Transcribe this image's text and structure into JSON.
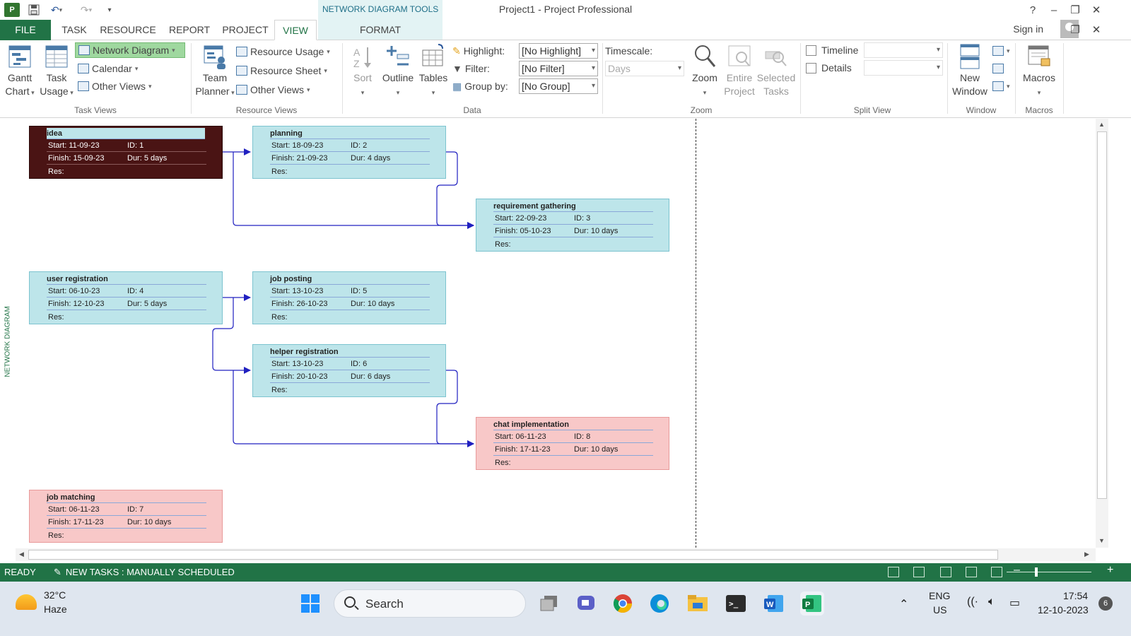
{
  "titlebar": {
    "app_icon": "P",
    "contextual_tab_group": "NETWORK DIAGRAM TOOLS",
    "window_title": "Project1 - Project Professional",
    "help": "?"
  },
  "tabs": [
    {
      "label": "FILE"
    },
    {
      "label": "TASK"
    },
    {
      "label": "RESOURCE"
    },
    {
      "label": "REPORT"
    },
    {
      "label": "PROJECT"
    },
    {
      "label": "VIEW"
    },
    {
      "label": "FORMAT"
    }
  ],
  "signin": "Sign in",
  "ribbon": {
    "task_views": {
      "label": "Task Views",
      "gantt_chart": [
        "Gantt",
        "Chart"
      ],
      "task_usage": [
        "Task",
        "Usage"
      ],
      "network_diagram": "Network Diagram",
      "calendar": "Calendar",
      "other_views": "Other Views"
    },
    "resource_views": {
      "label": "Resource Views",
      "team_planner": [
        "Team",
        "Planner"
      ],
      "resource_usage": "Resource Usage",
      "resource_sheet": "Resource Sheet",
      "other_views": "Other Views"
    },
    "data": {
      "label": "Data",
      "sort": "Sort",
      "outline": "Outline",
      "tables": "Tables",
      "highlight_label": "Highlight:",
      "highlight_value": "[No Highlight]",
      "filter_label": "Filter:",
      "filter_value": "[No Filter]",
      "groupby_label": "Group by:",
      "groupby_value": "[No Group]"
    },
    "zoom": {
      "label": "Zoom",
      "timescale_label": "Timescale:",
      "timescale_value": "Days",
      "zoom": "Zoom",
      "entire_project": [
        "Entire",
        "Project"
      ],
      "selected_tasks": [
        "Selected",
        "Tasks"
      ]
    },
    "split_view": {
      "label": "Split View",
      "timeline": "Timeline",
      "details": "Details"
    },
    "window": {
      "label": "Window",
      "new_window": [
        "New",
        "Window"
      ]
    },
    "macros": {
      "label": "Macros",
      "macros": "Macros"
    }
  },
  "diagram": {
    "view_label": "NETWORK DIAGRAM",
    "nodes": [
      {
        "name": "idea",
        "start": "Start:  11-09-23",
        "id": "ID:  1",
        "finish": "Finish: 15-09-23",
        "dur": "Dur: 5 days",
        "res": "Res:"
      },
      {
        "name": "planning",
        "start": "Start:  18-09-23",
        "id": "ID:  2",
        "finish": "Finish: 21-09-23",
        "dur": "Dur: 4 days",
        "res": "Res:"
      },
      {
        "name": "requirement gathering",
        "start": "Start:  22-09-23",
        "id": "ID:  3",
        "finish": "Finish: 05-10-23",
        "dur": "Dur: 10 days",
        "res": "Res:"
      },
      {
        "name": "user registration",
        "start": "Start:  06-10-23",
        "id": "ID:  4",
        "finish": "Finish: 12-10-23",
        "dur": "Dur: 5 days",
        "res": "Res:"
      },
      {
        "name": "job posting",
        "start": "Start:  13-10-23",
        "id": "ID:  5",
        "finish": "Finish: 26-10-23",
        "dur": "Dur: 10 days",
        "res": "Res:"
      },
      {
        "name": "helper registration",
        "start": "Start:  13-10-23",
        "id": "ID:  6",
        "finish": "Finish: 20-10-23",
        "dur": "Dur: 6 days",
        "res": "Res:"
      },
      {
        "name": "chat implementation",
        "start": "Start:  06-11-23",
        "id": "ID:  8",
        "finish": "Finish: 17-11-23",
        "dur": "Dur: 10 days",
        "res": "Res:"
      },
      {
        "name": "job matching",
        "start": "Start:  06-11-23",
        "id": "ID:  7",
        "finish": "Finish: 17-11-23",
        "dur": "Dur: 10 days",
        "res": "Res:"
      }
    ]
  },
  "statusbar": {
    "ready": "READY",
    "new_tasks": "NEW TASKS : MANUALLY SCHEDULED"
  },
  "taskbar": {
    "weather_temp": "32°C",
    "weather_cond": "Haze",
    "search_placeholder": "Search",
    "lang_line1": "ENG",
    "lang_line2": "US",
    "time": "17:54",
    "date": "12-10-2023",
    "notifications": "6"
  },
  "colors": {
    "accent": "#217346",
    "node_normal": "#bde5ea",
    "node_critical": "#f8c8c8",
    "node_selected": "#4a1414",
    "link": "#2020c0"
  }
}
